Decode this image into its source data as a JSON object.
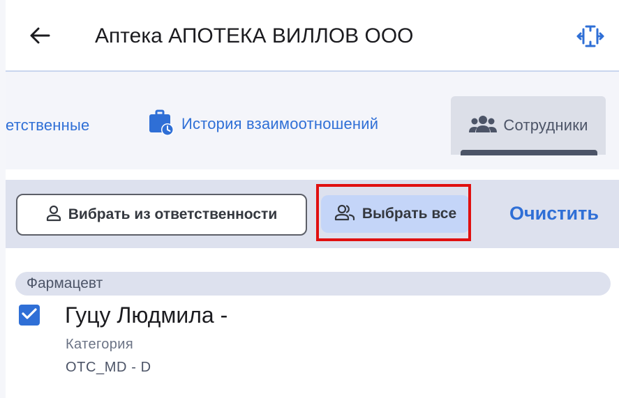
{
  "header": {
    "title": "Аптека АПОТЕКА ВИЛЛОВ ООО",
    "back_icon": "arrow-left-icon",
    "expand_icon": "expand-arrows-icon"
  },
  "tabs": [
    {
      "label": "етственные",
      "icon": "",
      "selected": false
    },
    {
      "label": "История взаимоотношений",
      "icon": "briefcase-clock-icon",
      "selected": false
    },
    {
      "label": "Сотрудники",
      "icon": "users-group-icon",
      "selected": true
    }
  ],
  "toolbar": {
    "select_from_responsibility_label": "Вибрать из ответственности",
    "select_all_label": "Выбрать все",
    "clear_label": "Очистить"
  },
  "list": {
    "group_label": "Фармацевт",
    "items": [
      {
        "name": "Гуцу Людмила -",
        "checked": true,
        "category_label": "Категория",
        "category_value": "OTC_MD - D"
      }
    ]
  },
  "colors": {
    "accent": "#2f6fd6",
    "highlight": "#e01010",
    "toolbar_bg": "#dde1ee",
    "tonal_button": "#c4d5f8"
  }
}
